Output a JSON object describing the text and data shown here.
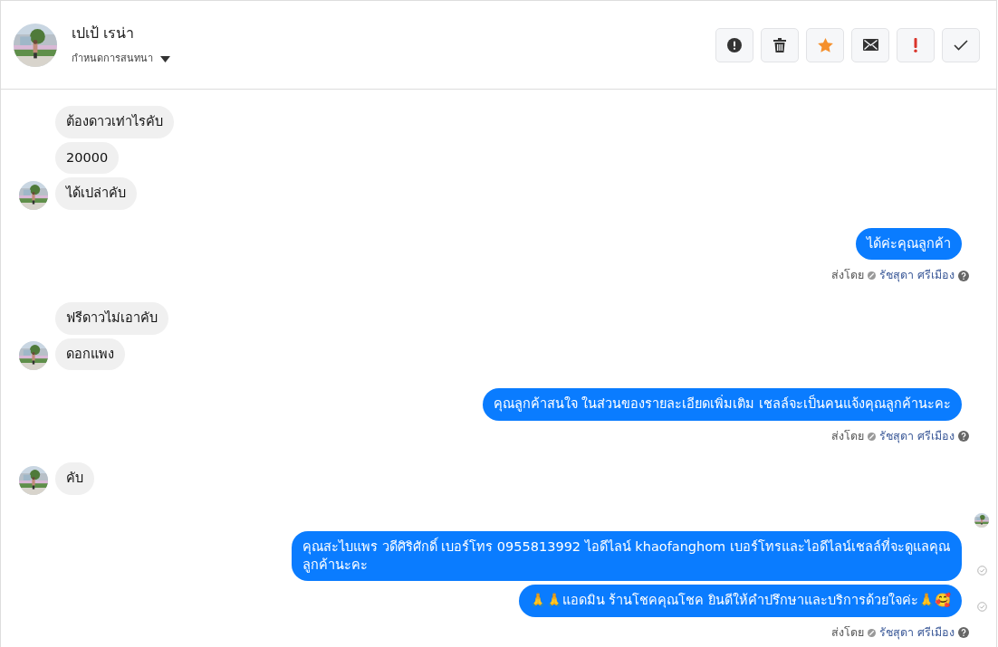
{
  "header": {
    "name": "เปเป้ เรน่า",
    "menu_label": "กำหนดการสนทนา"
  },
  "actions": [
    {
      "kind": "alert"
    },
    {
      "kind": "trash"
    },
    {
      "kind": "star"
    },
    {
      "kind": "mail"
    },
    {
      "kind": "important"
    },
    {
      "kind": "done"
    }
  ],
  "groups": [
    {
      "kind": "incoming",
      "messages": [
        {
          "text": "ต้องดาวเท่าไรคับ"
        },
        {
          "text": "20000"
        },
        {
          "text": "ได้เปล่าคับ"
        }
      ]
    },
    {
      "kind": "outgoing",
      "messages": [
        {
          "text": "ได้ค่ะคุณลูกค้า",
          "delivered": false
        }
      ],
      "sent_by": {
        "label": "ส่งโดย",
        "name": "รัชสุดา ศรีเมือง"
      },
      "seen": false
    },
    {
      "kind": "incoming",
      "messages": [
        {
          "text": "ฟรีดาวไม่เอาคับ"
        },
        {
          "text": "ดอกแพง"
        }
      ]
    },
    {
      "kind": "outgoing",
      "messages": [
        {
          "text": "คุณลูกค้าสนใจ ในส่วนของรายละเอียดเพิ่มเติม  เชลล์จะเป็นคนแจ้งคุณลูกค้านะคะ",
          "delivered": false
        }
      ],
      "sent_by": {
        "label": "ส่งโดย",
        "name": "รัชสุดา ศรีเมือง"
      },
      "seen": false
    },
    {
      "kind": "incoming",
      "messages": [
        {
          "text": "คับ"
        }
      ]
    },
    {
      "kind": "outgoing",
      "messages": [
        {
          "text": "คุณสะไบแพร วดีศิริศักดิ์ เบอร์โทร 0955813992  ไอดีไลน์  khaofanghom   เบอร์โทรและไอดีไลน์เชลล์ที่จะดูแลคุณลูกค้านะคะ",
          "delivered": true
        },
        {
          "text": "🙏🙏แอดมิน ร้านโชคคุณโชค ยินดีให้คำปรึกษาและบริการด้วยใจค่ะ🙏🥰",
          "delivered": true
        }
      ],
      "sent_by": {
        "label": "ส่งโดย",
        "name": "รัชสุดา ศรีเมือง"
      },
      "seen": true
    }
  ]
}
